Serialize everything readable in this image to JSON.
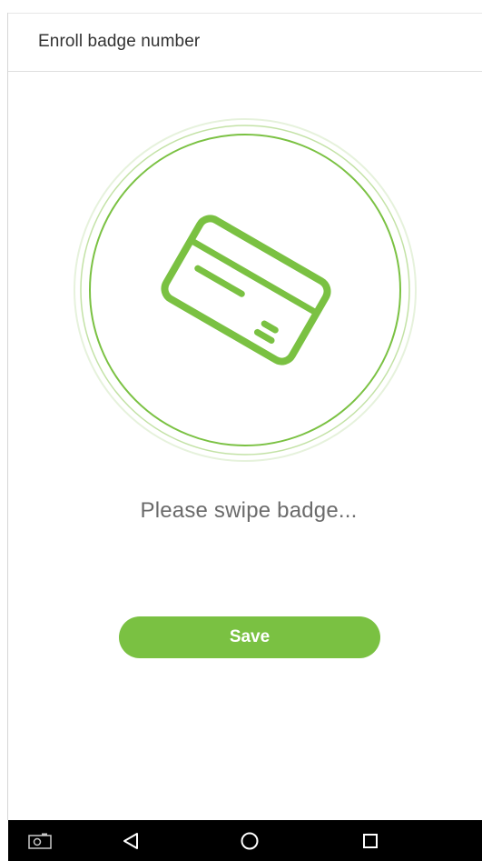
{
  "header": {
    "title": "Enroll badge number"
  },
  "graphic": {
    "icon": "badge-card-icon",
    "accent_color": "#7ac142"
  },
  "prompt": {
    "text": "Please swipe badge..."
  },
  "actions": {
    "save_label": "Save"
  },
  "navbar": {
    "buttons": [
      "screenshot-icon",
      "back-icon",
      "home-icon",
      "recents-icon"
    ]
  }
}
